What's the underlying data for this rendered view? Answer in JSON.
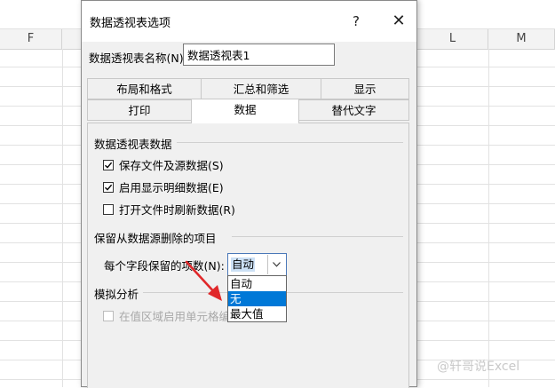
{
  "spreadsheet": {
    "columns": [
      "F",
      "L",
      "M"
    ]
  },
  "dialog": {
    "title": "数据透视表选项",
    "help": "?",
    "close": "✕",
    "name_label": "数据透视表名称(N):",
    "name_value": "数据透视表1",
    "tabs_row1": [
      "布局和格式",
      "汇总和筛选",
      "显示"
    ],
    "tabs_row2": [
      "打印",
      "数据",
      "替代文字"
    ],
    "active_tab": "数据",
    "section_pivot_data": {
      "title": "数据透视表数据",
      "options": [
        {
          "label": "保存文件及源数据(S)",
          "checked": true
        },
        {
          "label": "启用显示明细数据(E)",
          "checked": true
        },
        {
          "label": "打开文件时刷新数据(R)",
          "checked": false
        }
      ]
    },
    "section_retain": {
      "title": "保留从数据源删除的项目",
      "field_label": "每个字段保留的项数(N):",
      "combo_value": "自动",
      "dropdown_options": [
        "自动",
        "无",
        "最大值"
      ],
      "highlighted_option": "无"
    },
    "section_whatif": {
      "title": "模拟分析",
      "option_label": "在值区域启用单元格编",
      "option_enabled": false
    }
  },
  "annotation": {
    "arrow_color": "#e0282a"
  },
  "watermark": "@轩哥说Excel",
  "colors": {
    "selection": "#0078d7",
    "combo_border": "#4a78b8",
    "dialog_bg": "#f0f0f0"
  }
}
